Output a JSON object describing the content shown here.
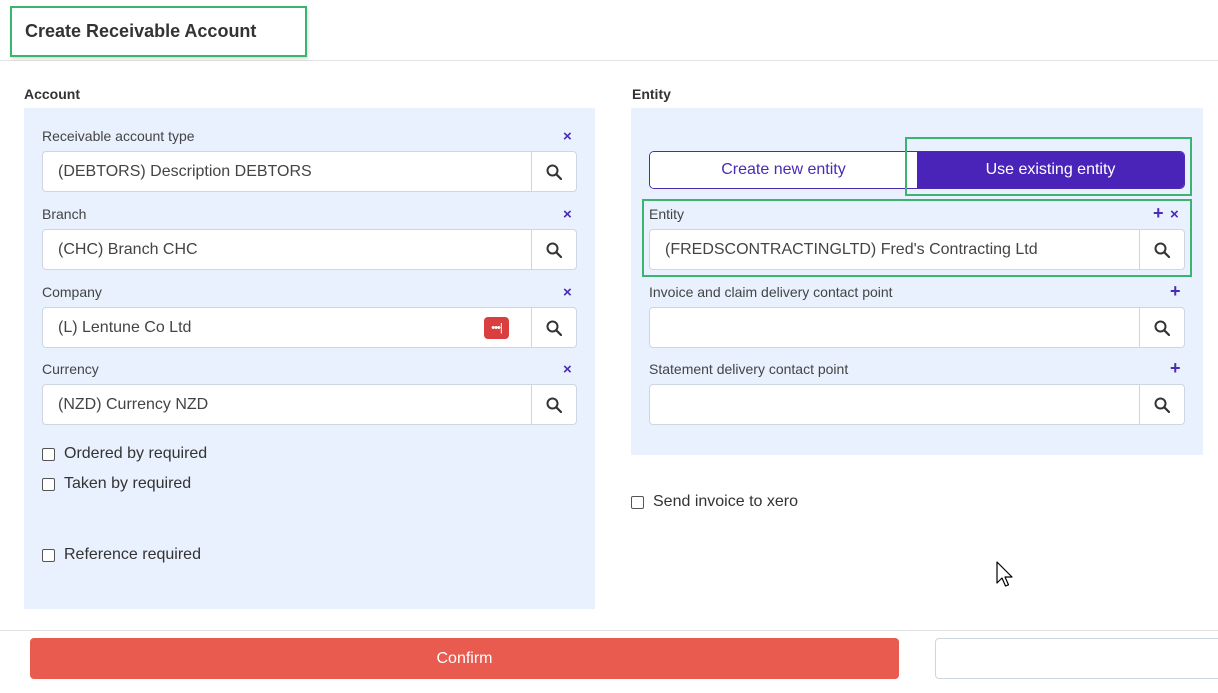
{
  "header": {
    "title": "Create Receivable Account"
  },
  "account": {
    "section_label": "Account",
    "fields": [
      {
        "label": "Receivable account type",
        "value": "(DEBTORS) Description DEBTORS"
      },
      {
        "label": "Branch",
        "value": "(CHC) Branch CHC"
      },
      {
        "label": "Company",
        "value": "(L) Lentune Co Ltd"
      },
      {
        "label": "Currency",
        "value": "(NZD) Currency NZD"
      }
    ],
    "checkboxes": {
      "ordered_by": "Ordered by required",
      "taken_by": "Taken by required",
      "reference": "Reference required"
    }
  },
  "entity": {
    "section_label": "Entity",
    "toggle": {
      "create_label": "Create new entity",
      "existing_label": "Use existing entity",
      "selected": "existing"
    },
    "entity_field": {
      "label": "Entity",
      "value": "(FREDSCONTRACTINGLTD) Fred's Contracting Ltd"
    },
    "invoice_contact": {
      "label": "Invoice and claim delivery contact point",
      "value": ""
    },
    "statement_contact": {
      "label": "Statement delivery contact point",
      "value": ""
    },
    "send_xero_label": "Send invoice to xero"
  },
  "icons": {
    "clear": "×",
    "add": "+",
    "password_manager": "•••|"
  },
  "footer": {
    "confirm_label": "Confirm"
  },
  "colors": {
    "accent": "#4a24b8",
    "panel_bg": "#e8f1fd",
    "confirm": "#e95b4f",
    "highlight": "#3cb371"
  }
}
